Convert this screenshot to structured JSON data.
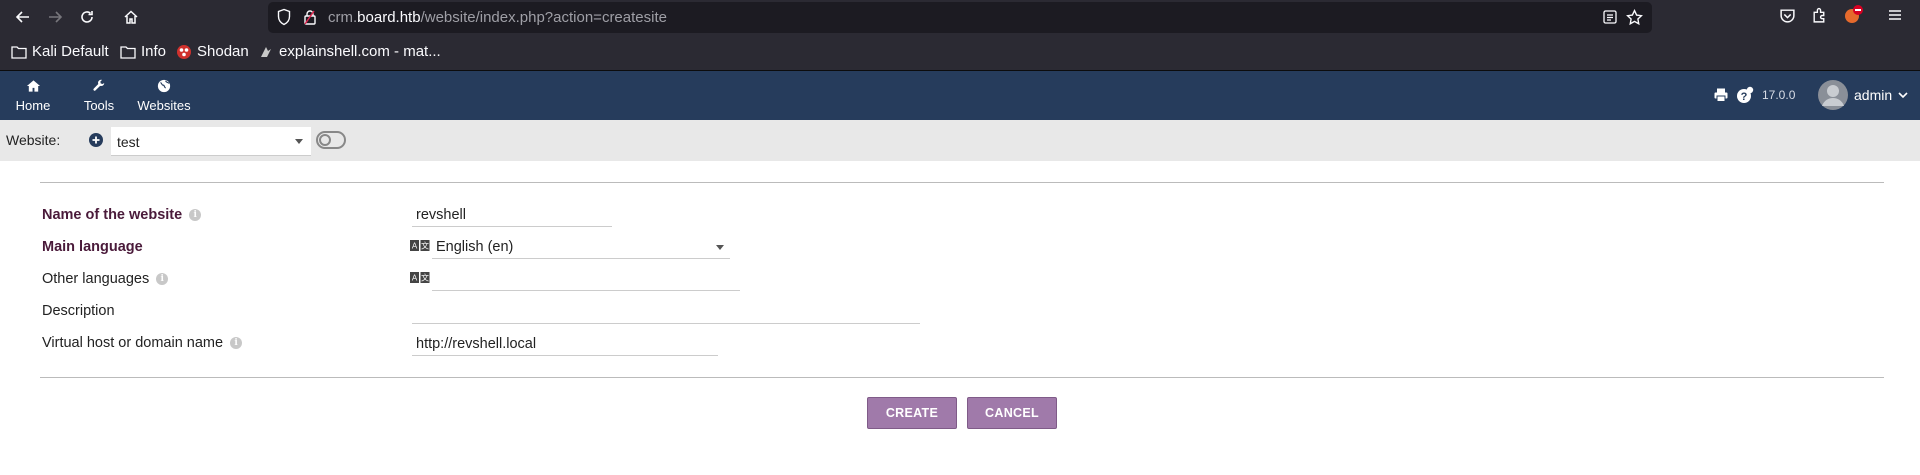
{
  "browser": {
    "url_prefix": "crm.",
    "url_domain": "board.htb",
    "url_path": "/website/index.php?action=createsite",
    "bookmarks": [
      {
        "label": "Kali Default",
        "icon": "folder-icon"
      },
      {
        "label": "Info",
        "icon": "folder-icon"
      },
      {
        "label": "Shodan",
        "icon": "shodan-icon"
      },
      {
        "label": "explainshell.com - mat...",
        "icon": "explainshell-icon"
      }
    ]
  },
  "app_nav": {
    "items": [
      {
        "label": "Home",
        "icon": "home-icon"
      },
      {
        "label": "Tools",
        "icon": "wrench-icon"
      },
      {
        "label": "Websites",
        "icon": "globe-icon"
      }
    ],
    "version": "17.0.0",
    "user": "admin"
  },
  "website_bar": {
    "label": "Website:",
    "selected": "test"
  },
  "form": {
    "name_label": "Name of the website",
    "name_value": "revshell",
    "main_lang_label": "Main language",
    "main_lang_value": "English (en)",
    "other_lang_label": "Other languages",
    "other_lang_value": "",
    "description_label": "Description",
    "description_value": "",
    "vhost_label": "Virtual host or domain name",
    "vhost_value": "http://revshell.local"
  },
  "buttons": {
    "create": "CREATE",
    "cancel": "CANCEL"
  },
  "colors": {
    "app_nav_bg": "#263c5c",
    "button_bg": "#a07aaa",
    "required_label": "#4a1a3a"
  }
}
